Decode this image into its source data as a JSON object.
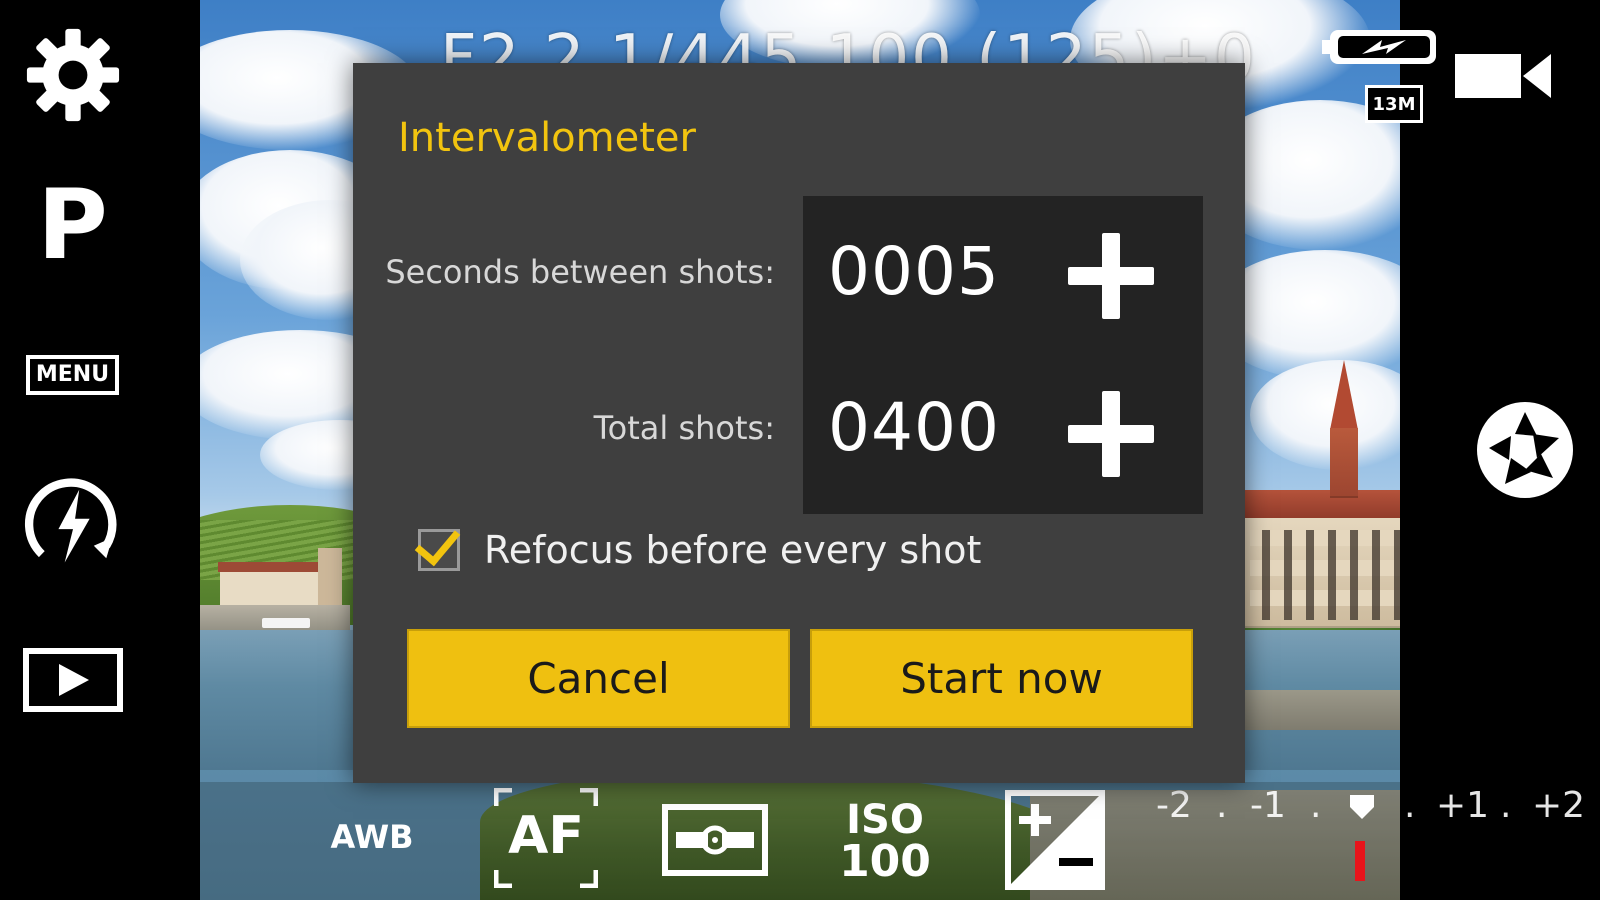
{
  "left_sidebar": {
    "settings_icon": "gear-icon",
    "mode_label": "P",
    "menu_label": "MENU",
    "flash_icon": "flash-auto-icon",
    "playback_icon": "play-icon"
  },
  "top_readout": {
    "exposure_text": "F2.2  1/445  100 (125)+0"
  },
  "right_sidebar": {
    "battery_icon": "battery-charging-icon",
    "resolution_badge": "13M",
    "video_icon": "video-camera-icon",
    "shutter_icon": "aperture-shutter-icon"
  },
  "bottom_bar": {
    "white_balance": "AWB",
    "focus_mode": "AF",
    "metering_icon": "metering-icon",
    "iso_label": "ISO",
    "iso_value": "100",
    "exposure_comp_icon": "exposure-compensation-icon",
    "ev_scale": {
      "labels": [
        "-2",
        ".",
        "-1",
        ".",
        ".",
        "+1",
        ".",
        "+2"
      ],
      "current_value": 0,
      "indicator_color": "#e8141b"
    }
  },
  "dialog": {
    "title": "Intervalometer",
    "seconds_label": "Seconds between shots:",
    "seconds_value": "0005",
    "total_label": "Total shots:",
    "total_value": "0400",
    "refocus_label": "Refocus before every shot",
    "refocus_checked": true,
    "cancel_label": "Cancel",
    "start_label": "Start now",
    "accent_color": "#f2c40f",
    "button_color": "#efc010"
  }
}
